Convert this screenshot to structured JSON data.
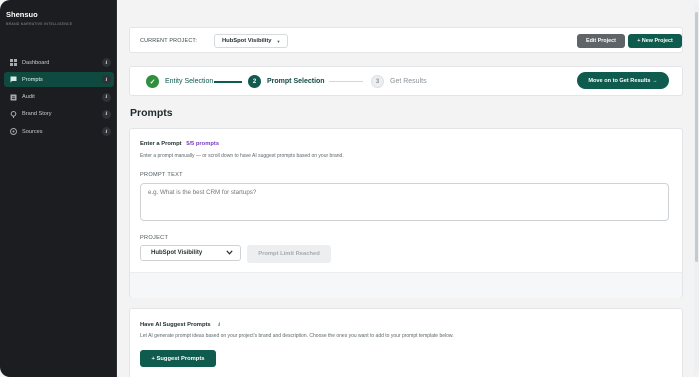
{
  "brand": {
    "name": "Shensuo",
    "tagline": "BRAND NARRATIVE INTELLIGENCE"
  },
  "sidebar": {
    "items": [
      {
        "label": "Dashboard",
        "icon": "grid-icon",
        "active": false
      },
      {
        "label": "Prompts",
        "icon": "chat-icon",
        "active": true
      },
      {
        "label": "Audit",
        "icon": "clipboard-icon",
        "active": false
      },
      {
        "label": "Brand Story",
        "icon": "pin-icon",
        "active": false
      },
      {
        "label": "Sources",
        "icon": "globe-icon",
        "active": false
      }
    ],
    "info_glyph": "i"
  },
  "project_bar": {
    "label": "CURRENT PROJECT:",
    "selected_project": "HubSpot Visibility",
    "edit_label": "Edit Project",
    "new_label": "+ New Project"
  },
  "steps": {
    "items": [
      {
        "number": "✓",
        "label": "Entity Selection",
        "state": "done"
      },
      {
        "number": "2",
        "label": "Prompt Selection",
        "state": "current"
      },
      {
        "number": "3",
        "label": "Get Results",
        "state": "upcoming"
      }
    ],
    "move_on_label": "Move on to Get Results →"
  },
  "page": {
    "title": "Prompts"
  },
  "prompt_form": {
    "title": "Enter a Prompt",
    "count": "5/5 prompts",
    "subtitle": "Enter a prompt manually — or scroll down to have AI suggest prompts based on your brand.",
    "prompt_label": "PROMPT TEXT",
    "prompt_placeholder": "e.g. What is the best CRM for startups?",
    "prompt_value": "",
    "project_label": "PROJECT",
    "project_value": "HubSpot Visibility",
    "limit_button": "Prompt Limit Reached"
  },
  "suggest": {
    "title": "Have AI Suggest Prompts",
    "subtitle": "Let AI generate prompt ideas based on your project's brand and description. Choose the ones you want to add to your prompt template below.",
    "button": "+ Suggest Prompts"
  },
  "colors": {
    "accent": "#0f5b4e",
    "sidebar_bg": "#1c1d20",
    "count_purple": "#7a3cc0",
    "step_done": "#2f8f3d"
  }
}
